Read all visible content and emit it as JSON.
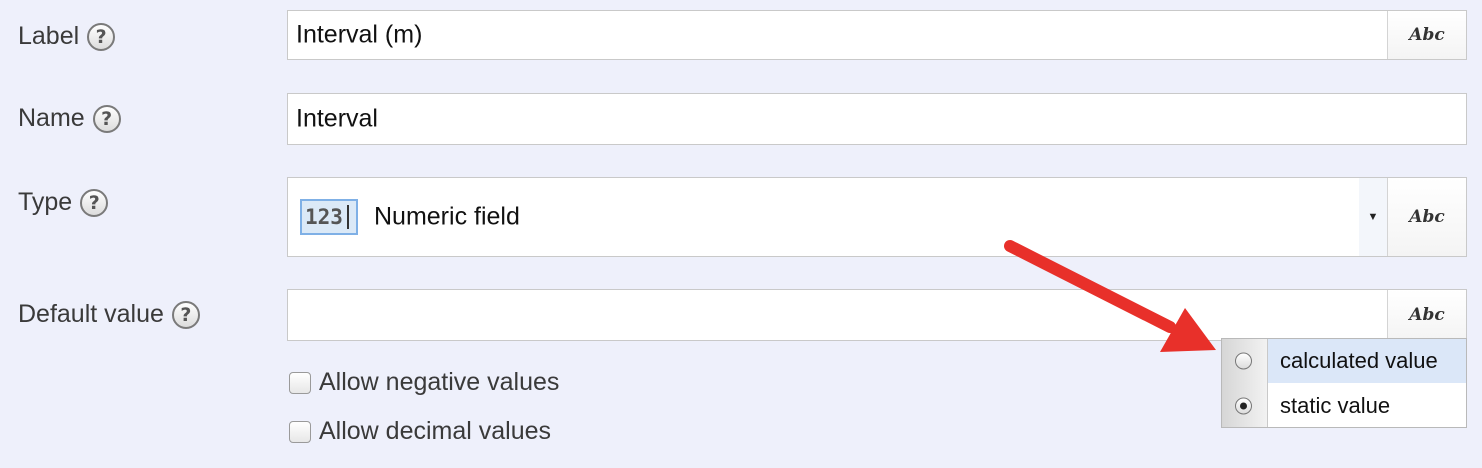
{
  "fields": {
    "label": {
      "label": "Label",
      "value": "Interval (m)",
      "suffix": "Abc"
    },
    "name": {
      "label": "Name",
      "value": "Interval"
    },
    "type": {
      "label": "Type",
      "badge": "123",
      "value": "Numeric field",
      "suffix": "Abc"
    },
    "default_value": {
      "label": "Default value",
      "value": "",
      "suffix": "Abc"
    }
  },
  "help_glyph": "?",
  "checkboxes": [
    {
      "label": "Allow negative values",
      "checked": false
    },
    {
      "label": "Allow decimal values",
      "checked": false
    }
  ],
  "popup": {
    "items": [
      {
        "label": "calculated value",
        "selected": false,
        "highlighted": true
      },
      {
        "label": "static value",
        "selected": true,
        "highlighted": false
      }
    ]
  },
  "colors": {
    "background": "#eef0fb",
    "annotation_arrow": "#e8302a",
    "highlight": "#dbe7f8"
  }
}
